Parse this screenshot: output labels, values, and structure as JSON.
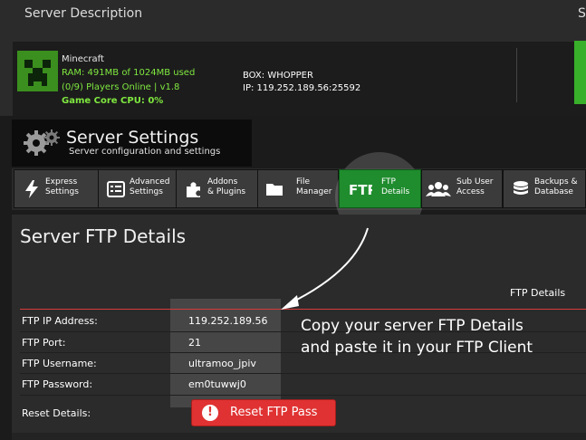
{
  "server_description": {
    "title": "Server Description",
    "title_cut": "S",
    "game": {
      "name": "Minecraft",
      "ram": "RAM: 491MB of 1024MB used",
      "players": "(0/9) Players Online | v1.8",
      "cpu": "Game Core CPU: 0%"
    },
    "box": {
      "name": "BOX: WHOPPER",
      "ip": "IP: 119.252.189.56:25592"
    }
  },
  "settings_header": {
    "title": "Server Settings",
    "subtitle": "Server configuration and settings"
  },
  "tabs": [
    {
      "line1": "Express",
      "line2": "Settings",
      "icon": "lightning-icon"
    },
    {
      "line1": "Advanced",
      "line2": "Settings",
      "icon": "settings-list-icon"
    },
    {
      "line1": "Addons",
      "line2": "& Plugins",
      "icon": "puzzle-icon"
    },
    {
      "line1": "File",
      "line2": "Manager",
      "icon": "folder-icon"
    },
    {
      "line1": "FTP",
      "line2": "Details",
      "icon": "ftp-icon",
      "active": true
    },
    {
      "line1": "Sub User",
      "line2": "Access",
      "icon": "users-icon"
    },
    {
      "line1": "Backups &",
      "line2": "Database",
      "icon": "database-icon"
    }
  ],
  "ftp": {
    "heading": "Server FTP Details",
    "section_label": "FTP Details",
    "rows": [
      {
        "label": "FTP IP Address:",
        "value": "119.252.189.56"
      },
      {
        "label": "FTP Port:",
        "value": "21"
      },
      {
        "label": "FTP Username:",
        "value": "ultramoo_jpiv"
      },
      {
        "label": "FTP Password:",
        "value": "em0tuwwj0"
      }
    ],
    "reset_label": "Reset Details:",
    "reset_button": "Reset FTP Pass",
    "reset_icon": "!"
  },
  "annotation": {
    "line1": "Copy your server FTP Details",
    "line2": "and paste it in your FTP Client"
  },
  "colors": {
    "active_tab": "#1f8c2e",
    "status_green": "#7fe83f",
    "reset_red": "#e03232",
    "divider_red": "#d83a3a"
  }
}
